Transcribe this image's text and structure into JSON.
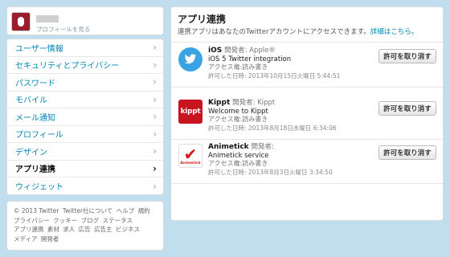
{
  "profile": {
    "view_profile": "プロフィールを見る"
  },
  "menu": {
    "items": [
      {
        "label": "ユーザー情報"
      },
      {
        "label": "セキュリティとプライバシー"
      },
      {
        "label": "パスワード"
      },
      {
        "label": "モバイル"
      },
      {
        "label": "メール通知"
      },
      {
        "label": "プロフィール"
      },
      {
        "label": "デザイン"
      },
      {
        "label": "アプリ連携",
        "active": true
      },
      {
        "label": "ウィジェット"
      }
    ],
    "chevron": "›"
  },
  "footer": {
    "links": [
      "© 2013 Twitter",
      "Twitter社について",
      "ヘルプ",
      "規約",
      "プライバシー",
      "クッキー",
      "ブログ",
      "ステータス",
      "アプリ連携",
      "素材",
      "求人",
      "広告",
      "広告主",
      "ビジネス",
      "メディア",
      "開発者"
    ]
  },
  "panel": {
    "title": "アプリ連携",
    "description": "連携アプリはあなたのTwitterアカウントにアクセスできます。",
    "details_link": "詳細はこちら。"
  },
  "apps": [
    {
      "name": "iOS",
      "developer": "開発者: Apple®",
      "description": "iOS 5 Twitter integration",
      "permission": "アクセス権:読み書き",
      "granted": "許可した日時: 2013年10月15日火曜日 5:44:51",
      "icon": "twitter-bird-icon",
      "button": "許可を取り消す"
    },
    {
      "name": "Kippt",
      "developer": "開発者: Kippt",
      "description": "Welcome to Kippt",
      "permission": "アクセス権:読み書き",
      "granted": "許可した日時: 2013年8月18日水曜日 6:34:06",
      "icon": "kippt-logo-icon",
      "icon_text": "kippt",
      "button": "許可を取り消す"
    },
    {
      "name": "Animetick",
      "developer": "開発者:",
      "description": "Animetick service",
      "permission": "アクセス権:読み書き",
      "granted": "許可した日時: 2013年8月3日火曜日 3:34:50",
      "icon": "animetick-logo-icon",
      "icon_text": "Animetick",
      "button": "許可を取り消す"
    }
  ],
  "colors": {
    "background": "#c0deed",
    "link": "#0084b4",
    "kippt_red": "#c8141e",
    "animetick_red": "#d21a1a",
    "twitter_blue": "#3aa3e3"
  }
}
